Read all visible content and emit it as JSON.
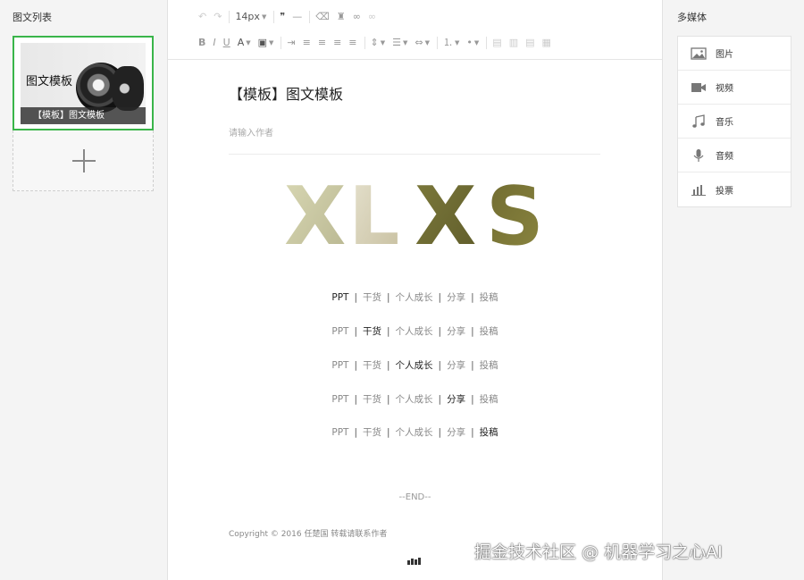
{
  "left_panel": {
    "title": "图文列表",
    "card": {
      "image_title": "图文模板",
      "caption": "【模板】图文模板"
    }
  },
  "toolbar": {
    "font_size": "14px"
  },
  "document": {
    "title": "【模板】图文模板",
    "author_placeholder": "请输入作者",
    "banner_letters": [
      "X",
      "L",
      "X",
      "S"
    ],
    "tags": [
      "PPT",
      "干货",
      "个人成长",
      "分享",
      "投稿"
    ],
    "separator": "|",
    "end": "--END--",
    "copyright": "Copyright © 2016 任楚国 转载请联系作者"
  },
  "right_panel": {
    "title": "多媒体",
    "items": [
      {
        "label": "图片",
        "icon": "image-icon"
      },
      {
        "label": "视频",
        "icon": "video-icon"
      },
      {
        "label": "音乐",
        "icon": "music-icon"
      },
      {
        "label": "音频",
        "icon": "microphone-icon"
      },
      {
        "label": "投票",
        "icon": "vote-chart-icon"
      }
    ]
  },
  "watermark": "掘金技术社区 @ 机器学习之心AI",
  "colors": {
    "selected_border": "#3ab54a"
  }
}
